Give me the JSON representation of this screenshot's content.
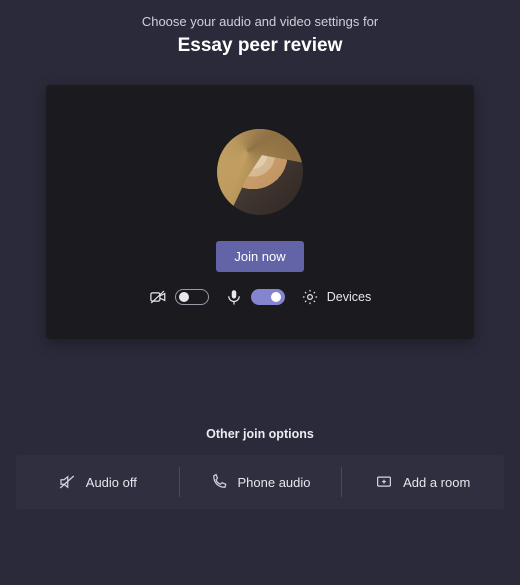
{
  "header": {
    "subtitle": "Choose your audio and video settings for",
    "title": "Essay peer review"
  },
  "preview": {
    "join_label": "Join now",
    "camera_on": false,
    "mic_on": true,
    "devices_label": "Devices"
  },
  "other": {
    "title": "Other join options",
    "options": [
      {
        "label": "Audio off"
      },
      {
        "label": "Phone audio"
      },
      {
        "label": "Add a room"
      }
    ]
  },
  "colors": {
    "accent": "#6264a7",
    "background": "#2b2a3a",
    "preview_bg": "#1a1a1f"
  }
}
